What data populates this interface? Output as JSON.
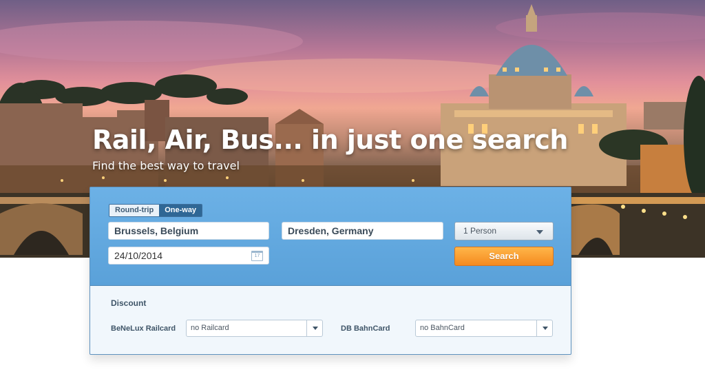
{
  "hero": {
    "headline": "Rail, Air, Bus... in just one search",
    "subheadline": "Find the best way to travel"
  },
  "search": {
    "trip_type": {
      "options": [
        "Round-trip",
        "One-way"
      ],
      "selected": "One-way"
    },
    "origin": "Brussels, Belgium",
    "destination": "Dresden, Germany",
    "date": "24/10/2014",
    "calendar_label": "17",
    "passengers": "1 Person",
    "search_label": "Search"
  },
  "discount": {
    "title": "Discount",
    "benelux": {
      "label": "BeNeLux Railcard",
      "value": "no Railcard"
    },
    "db": {
      "label": "DB BahnCard",
      "value": "no BahnCard"
    }
  },
  "colors": {
    "panel_blue": "#5aa1d9",
    "search_orange": "#f58a1f",
    "toggle_active": "#2f6795"
  }
}
